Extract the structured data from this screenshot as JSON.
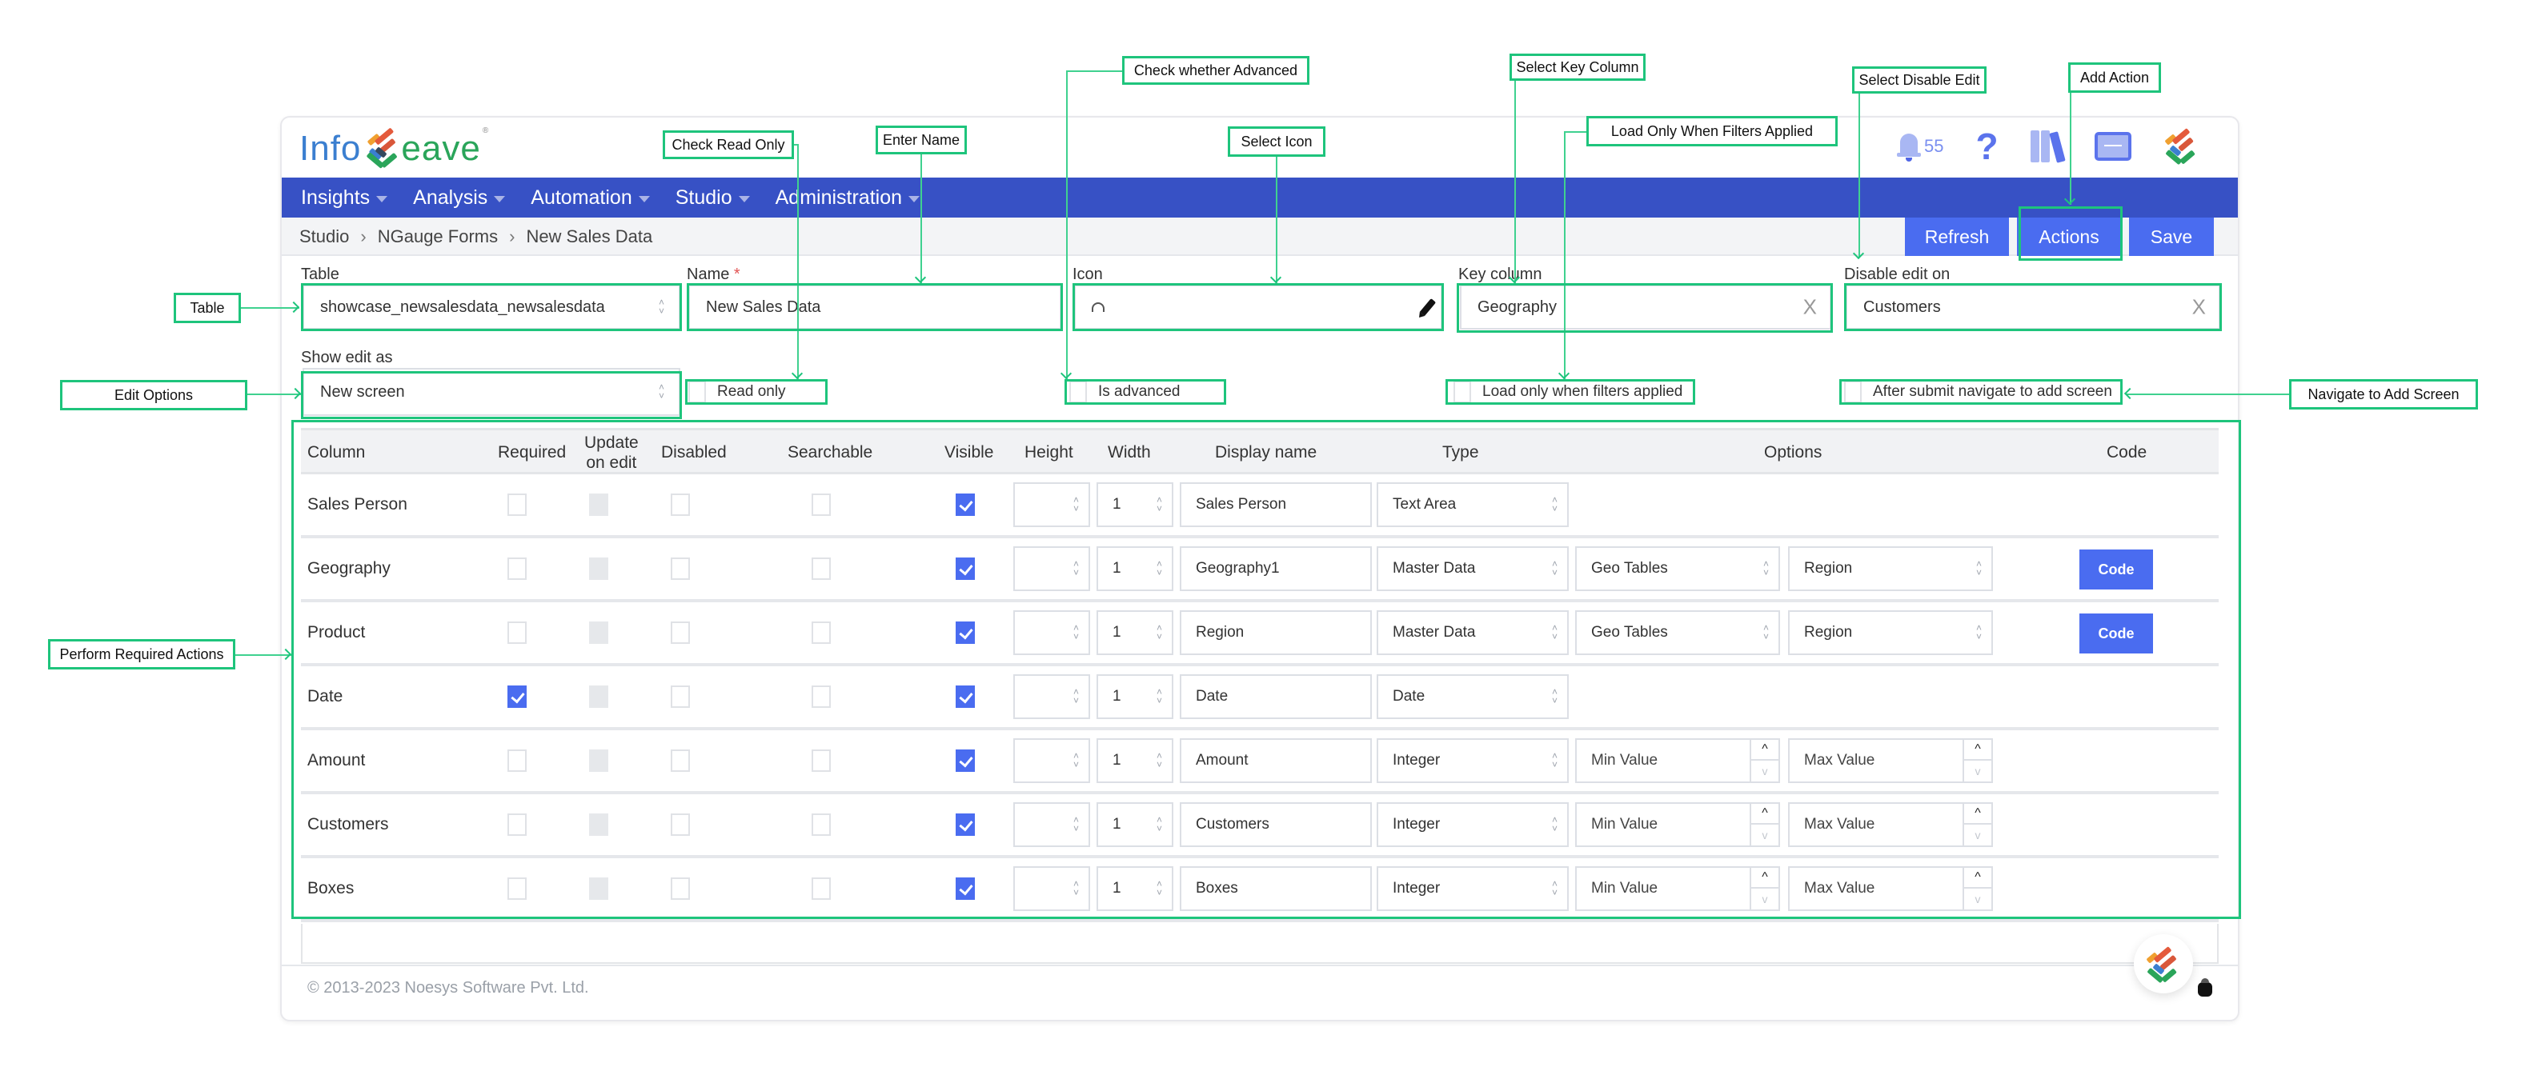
{
  "app": {
    "logo_left": "Info",
    "logo_right": "eave",
    "notification_count": "55",
    "help_glyph": "?",
    "icons": [
      "bell-icon",
      "help-icon",
      "library-icon",
      "monitor-icon",
      "infoveave-logo-icon"
    ]
  },
  "nav": {
    "items": [
      {
        "label": "Insights"
      },
      {
        "label": "Analysis"
      },
      {
        "label": "Automation"
      },
      {
        "label": "Studio"
      },
      {
        "label": "Administration"
      }
    ]
  },
  "breadcrumb": {
    "items": [
      "Studio",
      "NGauge Forms",
      "New Sales Data"
    ],
    "separator": "›"
  },
  "toolbar": {
    "refresh_label": "Refresh",
    "actions_label": "Actions",
    "save_label": "Save"
  },
  "form": {
    "table": {
      "label": "Table",
      "value": "showcase_newsalesdata_newsalesdata"
    },
    "name": {
      "label": "Name",
      "required_mark": "*",
      "value": "New Sales Data"
    },
    "icon": {
      "label": "Icon",
      "value": "dashboard-gauge-icon"
    },
    "key_column": {
      "label": "Key column",
      "value": "Geography"
    },
    "disable_edit_on": {
      "label": "Disable edit on",
      "value": "Customers"
    },
    "show_edit_as": {
      "label": "Show edit as",
      "value": "New screen"
    },
    "read_only": {
      "label": "Read only",
      "checked": false
    },
    "is_advanced": {
      "label": "Is advanced",
      "checked": false
    },
    "load_only_filters": {
      "label": "Load only when filters applied",
      "checked": false
    },
    "after_submit_navigate": {
      "label": "After submit navigate to add screen",
      "checked": false
    },
    "clear_glyph": "X"
  },
  "table": {
    "headers": {
      "column": "Column",
      "required": "Required",
      "update_on_edit_1": "Update",
      "update_on_edit_2": "on edit",
      "disabled": "Disabled",
      "searchable": "Searchable",
      "visible": "Visible",
      "height": "Height",
      "width": "Width",
      "display_name": "Display name",
      "type": "Type",
      "options": "Options",
      "code": "Code"
    },
    "rows": [
      {
        "column": "Sales Person",
        "required": false,
        "update_on_edit": false,
        "disabled": false,
        "searchable": false,
        "visible": true,
        "height": "",
        "width": "1",
        "display_name": "Sales Person",
        "type": "Text Area",
        "option1": "",
        "option2": "",
        "options_kind": "none",
        "code": ""
      },
      {
        "column": "Geography",
        "required": false,
        "update_on_edit": false,
        "disabled": false,
        "searchable": false,
        "visible": true,
        "height": "",
        "width": "1",
        "display_name": "Geography1",
        "type": "Master Data",
        "option1": "Geo Tables",
        "option2": "Region",
        "options_kind": "select",
        "code": "Code"
      },
      {
        "column": "Product",
        "required": false,
        "update_on_edit": false,
        "disabled": false,
        "searchable": false,
        "visible": true,
        "height": "",
        "width": "1",
        "display_name": "Region",
        "type": "Master Data",
        "option1": "Geo Tables",
        "option2": "Region",
        "options_kind": "select",
        "code": "Code"
      },
      {
        "column": "Date",
        "required": true,
        "update_on_edit": false,
        "disabled": false,
        "searchable": false,
        "visible": true,
        "height": "",
        "width": "1",
        "display_name": "Date",
        "type": "Date",
        "option1": "",
        "option2": "",
        "options_kind": "none",
        "code": ""
      },
      {
        "column": "Amount",
        "required": false,
        "update_on_edit": false,
        "disabled": false,
        "searchable": false,
        "visible": true,
        "height": "",
        "width": "1",
        "display_name": "Amount",
        "type": "Integer",
        "option1": "Min Value",
        "option2": "Max Value",
        "options_kind": "number",
        "code": ""
      },
      {
        "column": "Customers",
        "required": false,
        "update_on_edit": false,
        "disabled": false,
        "searchable": false,
        "visible": true,
        "height": "",
        "width": "1",
        "display_name": "Customers",
        "type": "Integer",
        "option1": "Min Value",
        "option2": "Max Value",
        "options_kind": "number",
        "code": ""
      },
      {
        "column": "Boxes",
        "required": false,
        "update_on_edit": false,
        "disabled": false,
        "searchable": false,
        "visible": true,
        "height": "",
        "width": "1",
        "display_name": "Boxes",
        "type": "Integer",
        "option1": "Min Value",
        "option2": "Max Value",
        "options_kind": "number",
        "code": ""
      }
    ]
  },
  "footer": {
    "copyright": "© 2013-2023 Noesys Software Pvt. Ltd."
  },
  "annotations": {
    "check_read_only": "Check Read Only",
    "enter_name": "Enter Name",
    "check_whether_advanced": "Check whether Advanced",
    "select_icon": "Select Icon",
    "select_key_column": "Select Key Column",
    "load_only_filters": "Load Only When  Filters Applied",
    "select_disable_edit": "Select Disable Edit",
    "add_action": "Add Action",
    "table": "Table",
    "edit_options": "Edit Options",
    "navigate_add_screen": "Navigate to Add Screen",
    "perform_required_actions": "Perform Required Actions"
  },
  "colors": {
    "nav": "#3751c5",
    "button": "#4a6cf0",
    "annotation": "#1ec47c"
  }
}
